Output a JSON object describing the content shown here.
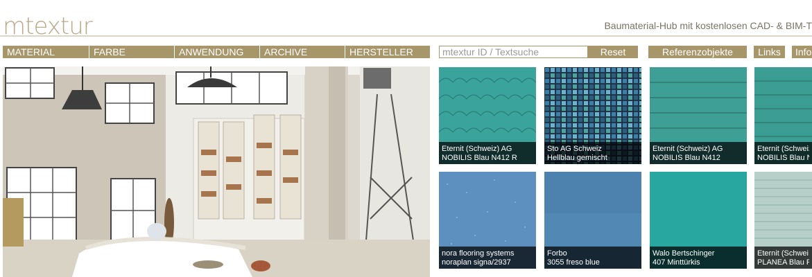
{
  "header": {
    "logo": "mtextur",
    "tagline": "Baumaterial-Hub mit kostenlosen CAD- & BIM-T"
  },
  "nav": {
    "items": [
      "MATERIAL",
      "FARBE",
      "ANWENDUNG",
      "ARCHIVE",
      "HERSTELLER"
    ],
    "search_placeholder": "mtextur ID / Textsuche",
    "reset": "Reset",
    "referenz": "Referenzobjekte",
    "links": "Links",
    "info": "Info"
  },
  "tiles": [
    {
      "maker": "Eternit (Schweiz) AG",
      "product": "NOBILIS Blau N412 R",
      "color": "#3aa39b"
    },
    {
      "maker": "Sto AG Schweiz",
      "product": "Hellblau gemischt",
      "color": "#3c6f86"
    },
    {
      "maker": "Eternit (Schweiz) AG",
      "product": "NOBILIS Blau N412",
      "color": "#3d9f96"
    },
    {
      "maker": "Eternit (Schweiz",
      "product": "NOBILIS Blau N",
      "color": "#3b9d94"
    },
    {
      "maker": "nora flooring systems",
      "product": "noraplan signa/2937",
      "color": "#5e90bf"
    },
    {
      "maker": "Forbo",
      "product": "3055 freso blue",
      "color": "#5188b4"
    },
    {
      "maker": "Walo Bertschinger",
      "product": "407 Minttürkis",
      "color": "#27a7a0"
    },
    {
      "maker": "Eternit (Schwei",
      "product": "PLANEA Blau F",
      "color": "#b7cfc9"
    }
  ]
}
